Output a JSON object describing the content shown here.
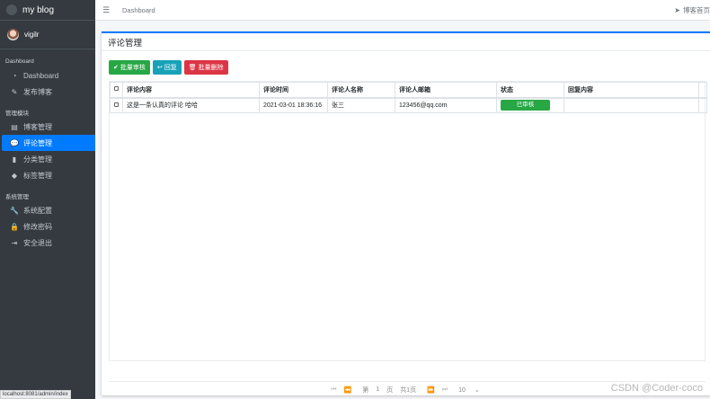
{
  "brand": {
    "title": "my blog"
  },
  "user": {
    "name": "vigilr"
  },
  "sidebar": {
    "sections": [
      {
        "header": "Dashboard",
        "items": [
          {
            "label": "Dashboard",
            "icon": "dashboard-icon"
          },
          {
            "label": "发布博客",
            "icon": "edit-icon"
          }
        ]
      },
      {
        "header": "管理模块",
        "items": [
          {
            "label": "博客管理",
            "icon": "list-icon"
          },
          {
            "label": "评论管理",
            "icon": "comments-icon",
            "active": true
          },
          {
            "label": "分类管理",
            "icon": "bookmark-icon"
          },
          {
            "label": "标签管理",
            "icon": "tags-icon"
          }
        ]
      },
      {
        "header": "系统管理",
        "items": [
          {
            "label": "系统配置",
            "icon": "wrench-icon"
          },
          {
            "label": "修改密码",
            "icon": "lock-icon"
          },
          {
            "label": "安全退出",
            "icon": "sign-out-icon"
          }
        ]
      }
    ]
  },
  "topbar": {
    "breadcrumb": "Dashboard",
    "blog_link": "博客首页"
  },
  "page": {
    "title": "评论管理"
  },
  "toolbar": {
    "approve_label": "批量审核",
    "reply_label": "回复",
    "delete_label": "批量删除"
  },
  "table": {
    "headers": [
      "评论内容",
      "评论时间",
      "评论人名称",
      "评论人邮箱",
      "状态",
      "回复内容"
    ],
    "rows": [
      {
        "content": "这是一条认真的评论 哈哈",
        "time": "2021-03-01 18:36:16",
        "name": "张三",
        "email": "123456@qq.com",
        "status": "已审核",
        "reply": ""
      }
    ]
  },
  "pager": {
    "page_prefix": "第",
    "page_value": "1",
    "page_suffix": "页",
    "total": "共1页",
    "page_size": "10"
  },
  "status_url": "localhost:8081/admin/index",
  "watermark": "CSDN @Coder-coco",
  "colors": {
    "sidebar": "#343a40",
    "accent": "#007bff",
    "success": "#28a745",
    "info": "#17a2b8",
    "danger": "#dc3545"
  }
}
